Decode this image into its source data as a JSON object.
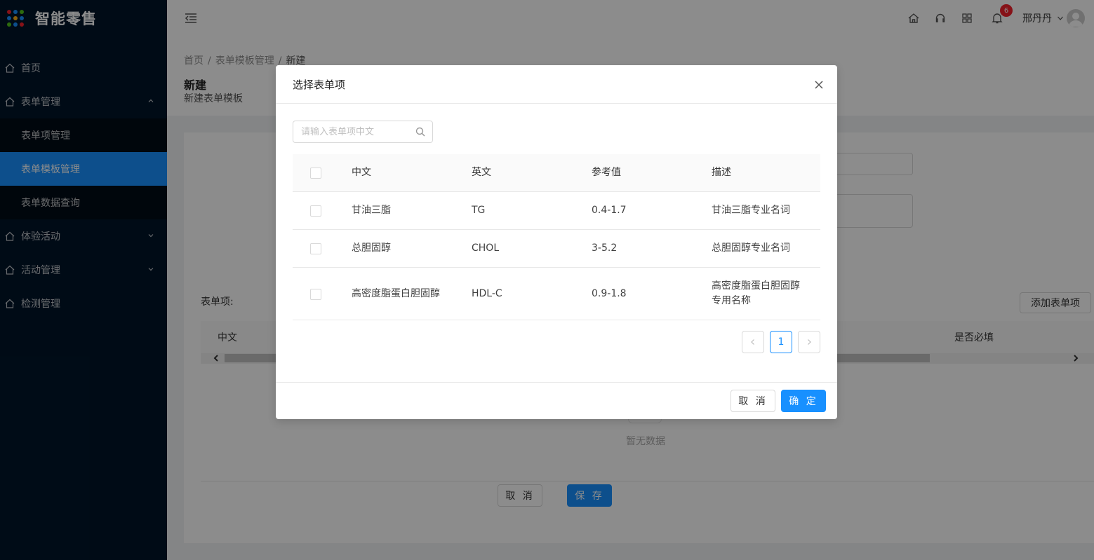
{
  "app": {
    "title": "智能零售",
    "logo_colors": [
      "#f5222d",
      "#1890ff",
      "#52c41a",
      "#1890ff",
      "#faad14",
      "#1890ff",
      "#52c41a",
      "#1890ff",
      "#f5222d"
    ]
  },
  "sidebar": {
    "items": [
      {
        "label": "首页",
        "icon": "home-icon"
      },
      {
        "label": "表单管理",
        "icon": "home-icon",
        "expanded": true
      },
      {
        "label": "体验活动",
        "icon": "home-icon"
      },
      {
        "label": "活动管理",
        "icon": "home-icon"
      },
      {
        "label": "检测管理",
        "icon": "home-icon"
      }
    ],
    "sub_items": [
      {
        "label": "表单项管理"
      },
      {
        "label": "表单模板管理",
        "active": true
      },
      {
        "label": "表单数据查询"
      }
    ]
  },
  "header": {
    "notification_count": "6",
    "user_name": "邢丹丹",
    "icons": [
      "home-icon",
      "headset-icon",
      "apps-icon",
      "bell-icon"
    ]
  },
  "breadcrumb": {
    "items": [
      "首页",
      "表单模板管理",
      "新建"
    ],
    "separator": "/"
  },
  "page": {
    "title": "新建",
    "description": "新建表单模板"
  },
  "form": {
    "items_label": "表单项:",
    "add_button": "添加表单项",
    "table_columns": [
      "中文",
      "是否必填"
    ],
    "empty_text": "暂无数据",
    "cancel_button": "取 消",
    "save_button": "保 存"
  },
  "modal": {
    "title": "选择表单项",
    "search_placeholder": "请输入表单项中文",
    "columns": [
      "中文",
      "英文",
      "参考值",
      "描述"
    ],
    "rows": [
      {
        "zh": "甘油三脂",
        "en": "TG",
        "ref": "0.4-1.7",
        "desc": "甘油三脂专业名词"
      },
      {
        "zh": "总胆固醇",
        "en": "CHOL",
        "ref": "3-5.2",
        "desc": "总胆固醇专业名词"
      },
      {
        "zh": "高密度脂蛋白胆固醇",
        "en": "HDL-C",
        "ref": "0.9-1.8",
        "desc": "高密度脂蛋白胆固醇专用名称"
      }
    ],
    "pagination": {
      "current": "1"
    },
    "cancel_button": "取 消",
    "ok_button": "确 定"
  },
  "colors": {
    "primary": "#1890ff",
    "sidebar_bg": "#001529",
    "badge": "#f5222d"
  }
}
